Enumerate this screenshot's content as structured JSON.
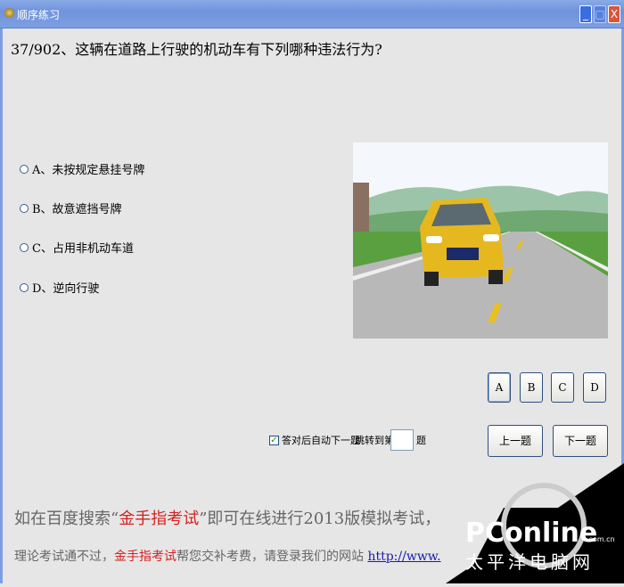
{
  "window": {
    "title": "顺序练习",
    "minimize": "_",
    "maximize": "□",
    "close": "X"
  },
  "question": {
    "text": "37/902、这辆在道路上行驶的机动车有下列哪种违法行为?"
  },
  "options": [
    {
      "label": "A、未按规定悬挂号牌"
    },
    {
      "label": "B、故意遮挡号牌"
    },
    {
      "label": "C、占用非机动车道"
    },
    {
      "label": "D、逆向行驶"
    }
  ],
  "answer_buttons": [
    {
      "label": "A",
      "selected": true
    },
    {
      "label": "B"
    },
    {
      "label": "C"
    },
    {
      "label": "D"
    }
  ],
  "nav": {
    "prev": "上一题",
    "next": "下一题"
  },
  "auto_next": {
    "label": "答对后自动下一题",
    "checked": true
  },
  "jump": {
    "prefix": "跳转到第",
    "suffix": "题",
    "value": ""
  },
  "ad": {
    "line1_a": "如在百度搜索“",
    "line1_red": "金手指考试",
    "line1_b": "”即可在线进行2013版模拟考试，",
    "line2_a": "理论考试通不过，",
    "line2_red": "金手指考试",
    "line2_b": "帮您交补考费，请登录我们的网站 ",
    "line2_link": "http://www."
  },
  "watermark": {
    "brand": "PConline",
    "domain": ".com.cn",
    "cn": "太平洋电脑网"
  }
}
